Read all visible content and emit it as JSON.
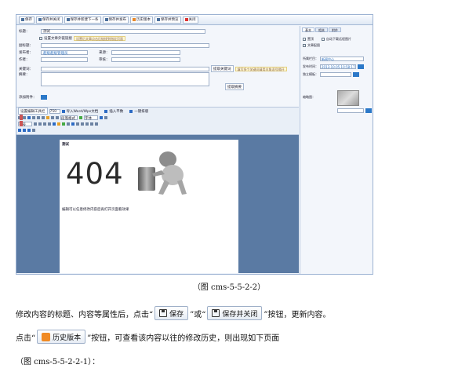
{
  "toolbar": {
    "save": "保存",
    "save_close": "保存并关闭",
    "save_next": "保存并新建下一条",
    "save_preview": "保存并发布",
    "history": "历史版本",
    "save_view": "保存并预览",
    "close": "关闭"
  },
  "form": {
    "title_label": "标题：",
    "title_value": "测试",
    "chk_label": "设置文章外链链接",
    "chk_hint": "设置后文章点击后链接到指定页面",
    "subtitle_label": "副标题：",
    "pub_label": "发布者：",
    "pub_value": "超级超级管理员",
    "source_label": "来源：",
    "author_label": "作者：",
    "editor_label": "审核：",
    "kw_label": "关键词：",
    "kw_btn": "提取关键词",
    "kw_hint": "填写多个关键词请用半角逗号隔开",
    "summary_label": "摘要：",
    "summary_btn": "提取摘要",
    "attach_label": "添加附件："
  },
  "editor": {
    "mode_btn": "设置编辑工具栏",
    "size": "750",
    "import_word": "导入Word/Wps文档",
    "import_img": "插入平数",
    "one_key": "一键排版",
    "font_fmt": "段落格式",
    "font_family": "字体",
    "font_size": "字号"
  },
  "page": {
    "title": "测试",
    "big": "404",
    "line": "编辑可以任意修改内容后再打开页面看效果"
  },
  "side": {
    "tabs": [
      "基本",
      "相关",
      "附件"
    ],
    "top_label": "置顶",
    "dl_label": "自动下载远程图片",
    "pic_label": "文章配图",
    "cat_label": "所属栏目：",
    "cat_value": "新闻中心",
    "date_label": "发布时间：",
    "date_value": "2013-10-05 10:58:17",
    "tpl_label": "独立模板：",
    "thumb_label": "缩略图："
  },
  "caption": "（图 cms-5-5-2-2）",
  "para1": {
    "before": "修改内容的标题、内容等属性后，点击“",
    "btn1": "保存",
    "mid": "”或“",
    "btn2": "保存并关闭",
    "after": "”按钮，更新内容。"
  },
  "para2": {
    "before": "点击“",
    "btn": "历史版本",
    "after": "”按钮，可查看该内容以往的修改历史，则出现如下页面"
  },
  "para3": "（图 cms-5-5-2-2-1）："
}
